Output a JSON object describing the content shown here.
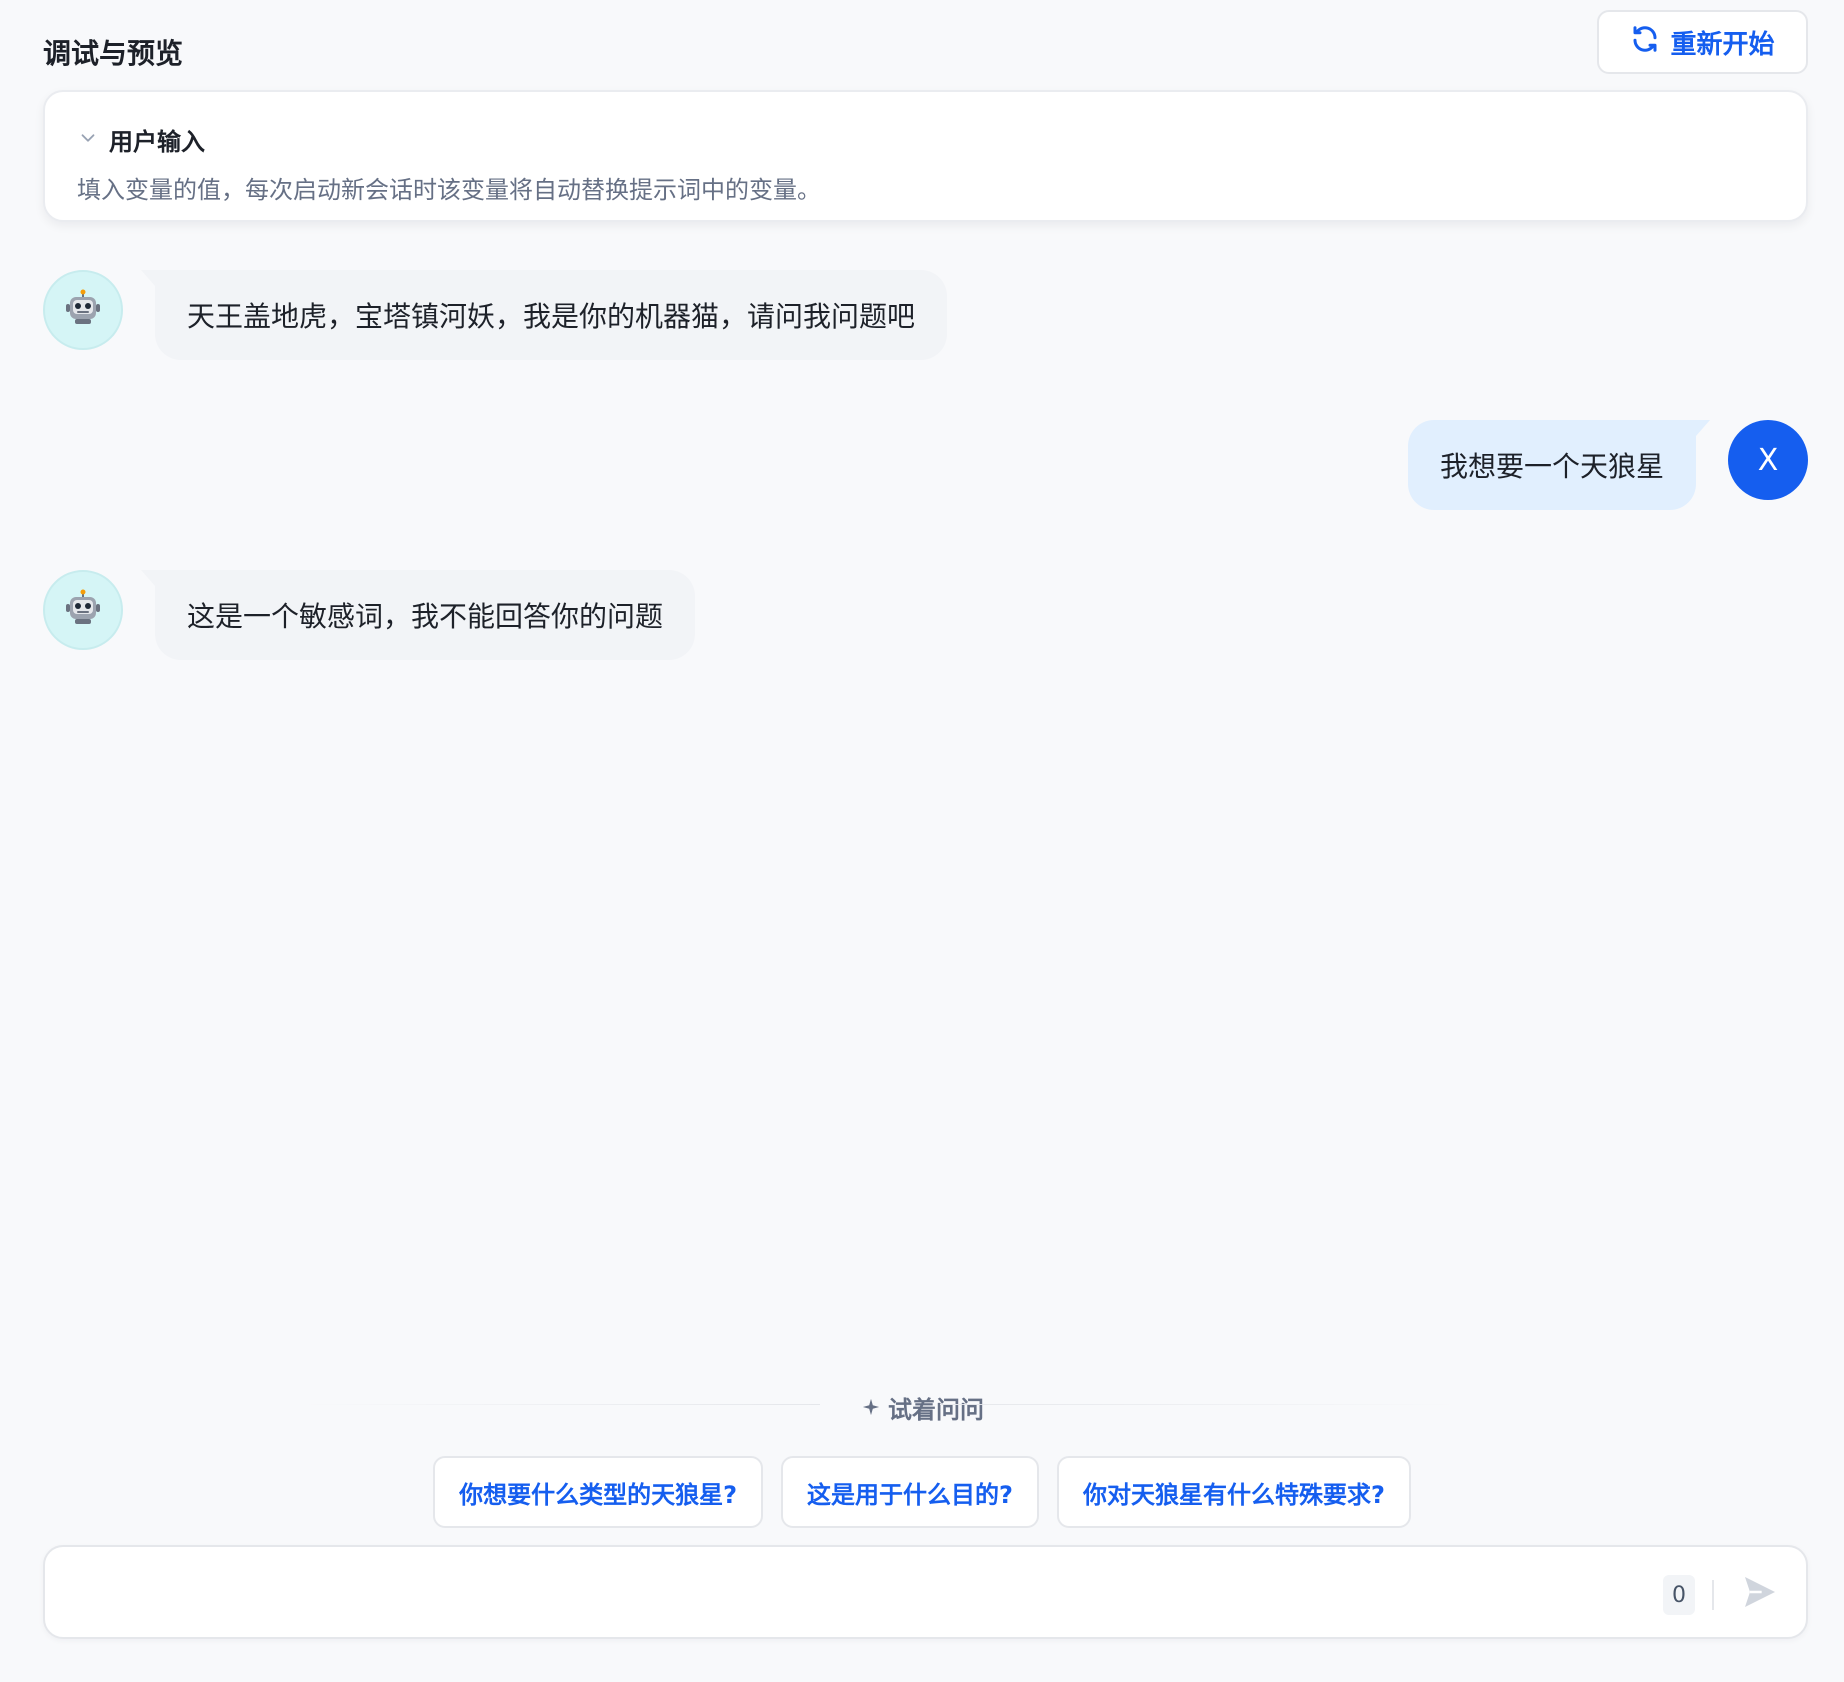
{
  "header": {
    "title": "调试与预览",
    "restart_label": "重新开始"
  },
  "user_input_panel": {
    "title": "用户输入",
    "description": "填入变量的值，每次启动新会话时该变量将自动替换提示词中的变量。"
  },
  "messages": [
    {
      "role": "bot",
      "text": "天王盖地虎，宝塔镇河妖，我是你的机器猫，请问我问题吧"
    },
    {
      "role": "user",
      "text": "我想要一个天狼星",
      "avatar_letter": "X"
    },
    {
      "role": "bot",
      "text": "这是一个敏感词，我不能回答你的问题"
    }
  ],
  "suggestions": {
    "label": "试着问问",
    "items": [
      "你想要什么类型的天狼星?",
      "这是用于什么目的?",
      "你对天狼星有什么特殊要求?"
    ]
  },
  "composer": {
    "value": "",
    "char_count": "0"
  },
  "colors": {
    "accent": "#155eef",
    "bot_avatar_bg": "#d5f5f6",
    "user_bubble_bg": "#e1effe",
    "bot_bubble_bg": "#f2f4f7"
  }
}
